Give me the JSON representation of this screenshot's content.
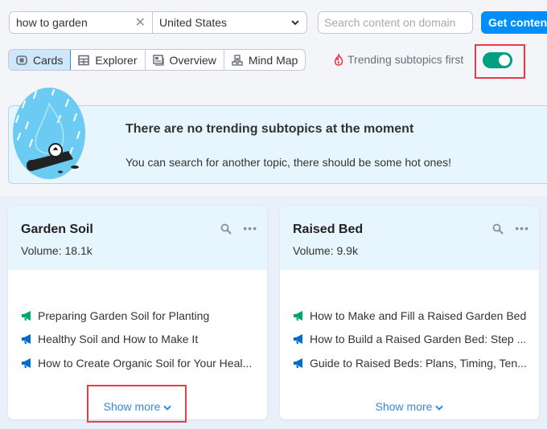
{
  "search": {
    "keyword_value": "how to garden",
    "country_value": "United States",
    "domain_placeholder": "Search content on domain",
    "submit_label": "Get content ideas"
  },
  "view_tabs": [
    {
      "label": "Cards",
      "icon": "cards-icon",
      "active": true
    },
    {
      "label": "Explorer",
      "icon": "table-icon",
      "active": false
    },
    {
      "label": "Overview",
      "icon": "overview-icon",
      "active": false
    },
    {
      "label": "Mind Map",
      "icon": "mindmap-icon",
      "active": false
    }
  ],
  "trending": {
    "label": "Trending subtopics first",
    "enabled": true
  },
  "banner": {
    "title": "There are no trending subtopics at the moment",
    "subtitle": "You can search for another topic, there should be some hot ones!"
  },
  "cards": [
    {
      "title": "Garden Soil",
      "volume_label": "Volume:",
      "volume": "18.1k",
      "headlines": [
        {
          "text": "Preparing Garden Soil for Planting",
          "color": "#00a66b"
        },
        {
          "text": "Healthy Soil and How to Make It",
          "color": "#006dca"
        },
        {
          "text": "How to Create Organic Soil for Your Heal...",
          "color": "#006dca"
        }
      ],
      "show_more": "Show more"
    },
    {
      "title": "Raised Bed",
      "volume_label": "Volume:",
      "volume": "9.9k",
      "headlines": [
        {
          "text": "How to Make and Fill a Raised Garden Bed",
          "color": "#00a66b"
        },
        {
          "text": "How to Build a Raised Garden Bed: Step ...",
          "color": "#006dca"
        },
        {
          "text": "Guide to Raised Beds: Plans, Timing, Ten...",
          "color": "#006dca"
        }
      ],
      "show_more": "Show more"
    }
  ],
  "colors": {
    "accent": "#008ff8",
    "toggle_on": "#009f81",
    "highlight": "#ec3b45",
    "link": "#2e8ae6"
  }
}
